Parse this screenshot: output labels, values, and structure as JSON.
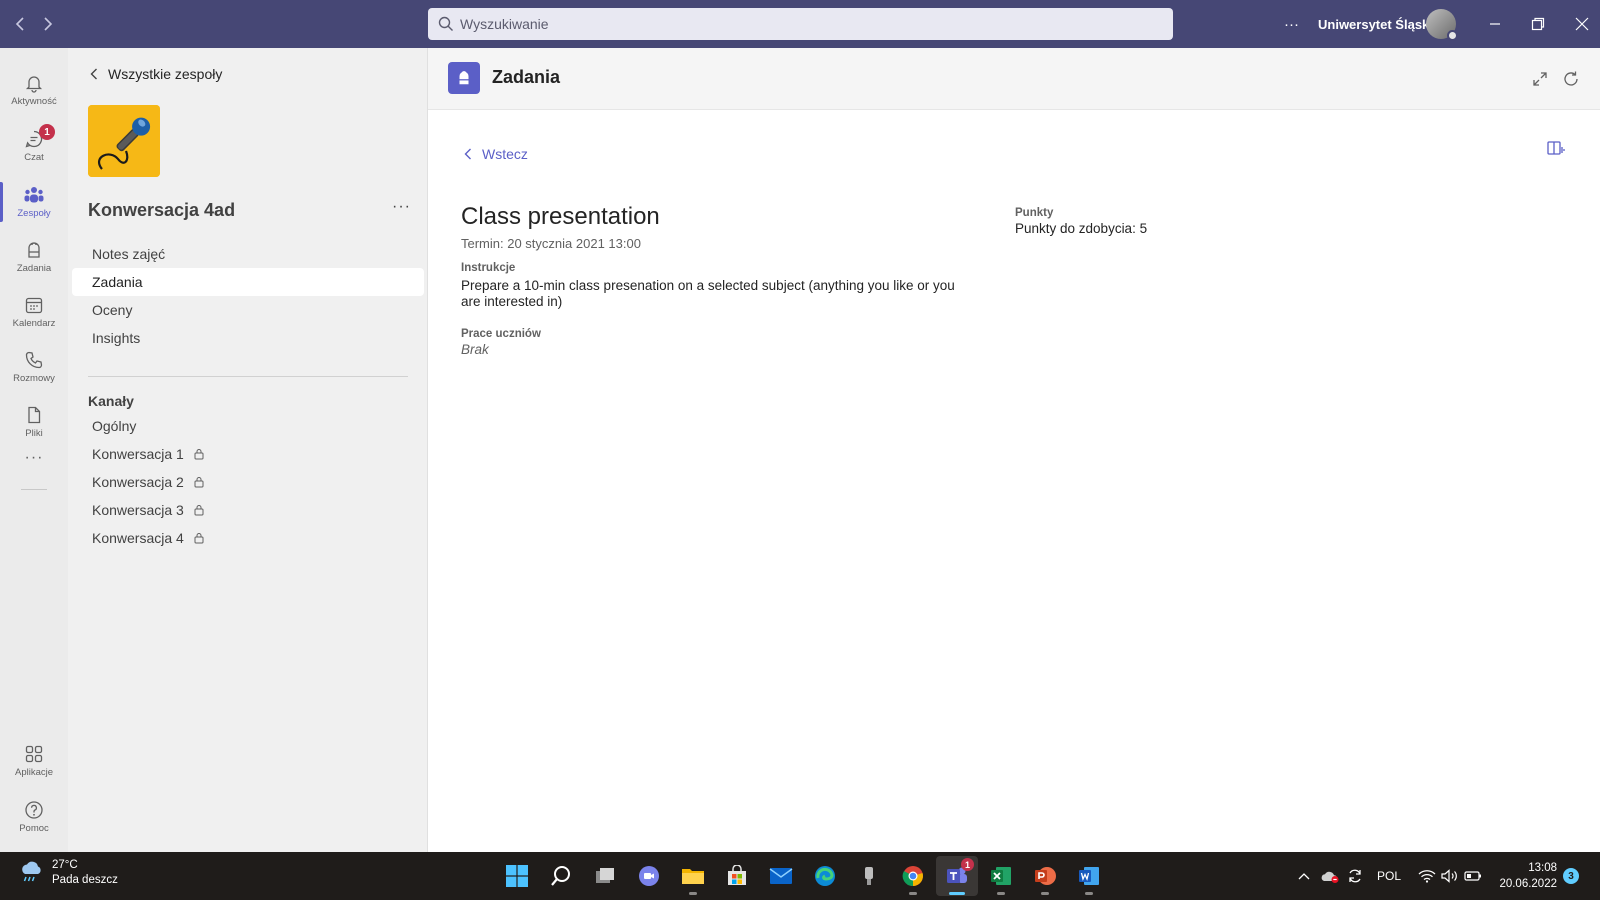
{
  "titlebar": {
    "search_placeholder": "Wyszukiwanie",
    "more_label": "···",
    "org_name": "Uniwersytet Śląski"
  },
  "rail": {
    "items": [
      {
        "label": "Aktywność",
        "icon": "bell-icon"
      },
      {
        "label": "Czat",
        "icon": "chat-icon",
        "badge": "1"
      },
      {
        "label": "Zespoły",
        "icon": "teams-icon"
      },
      {
        "label": "Zadania",
        "icon": "assignments-icon"
      },
      {
        "label": "Kalendarz",
        "icon": "calendar-icon"
      },
      {
        "label": "Rozmowy",
        "icon": "phone-icon"
      },
      {
        "label": "Pliki",
        "icon": "file-icon"
      }
    ],
    "more": "···",
    "apps_label": "Aplikacje",
    "help_label": "Pomoc",
    "active_index": 2,
    "accent": "#5b5fc7"
  },
  "team": {
    "back_label": "Wszystkie zespoły",
    "name": "Konwersacja 4ad",
    "more": "···",
    "tabs": [
      "Notes zajęć",
      "Zadania",
      "Oceny",
      "Insights"
    ],
    "active_tab": 1,
    "channels_header": "Kanały",
    "general_channel": "Ogólny",
    "channels": [
      "Konwersacja 1",
      "Konwersacja 2",
      "Konwersacja 3",
      "Konwersacja 4"
    ]
  },
  "app": {
    "title": "Zadania",
    "back_label": "Wstecz",
    "assignment": {
      "title": "Class presentation",
      "due": "Termin: 20 stycznia 2021 13:00",
      "instructions_label": "Instrukcje",
      "instructions": "Prepare a 10-min class presenation on a selected subject (anything you like or you are interested in)",
      "student_work_label": "Prace uczniów",
      "student_work_value": "Brak",
      "points_label": "Punkty",
      "points_value": "Punkty do zdobycia: 5"
    }
  },
  "taskbar": {
    "weather_temp": "27°C",
    "weather_desc": "Pada deszcz",
    "language": "POL",
    "time": "13:08",
    "date": "20.06.2022",
    "notifications": "3",
    "teams_badge": "1",
    "active_app": "teams"
  }
}
